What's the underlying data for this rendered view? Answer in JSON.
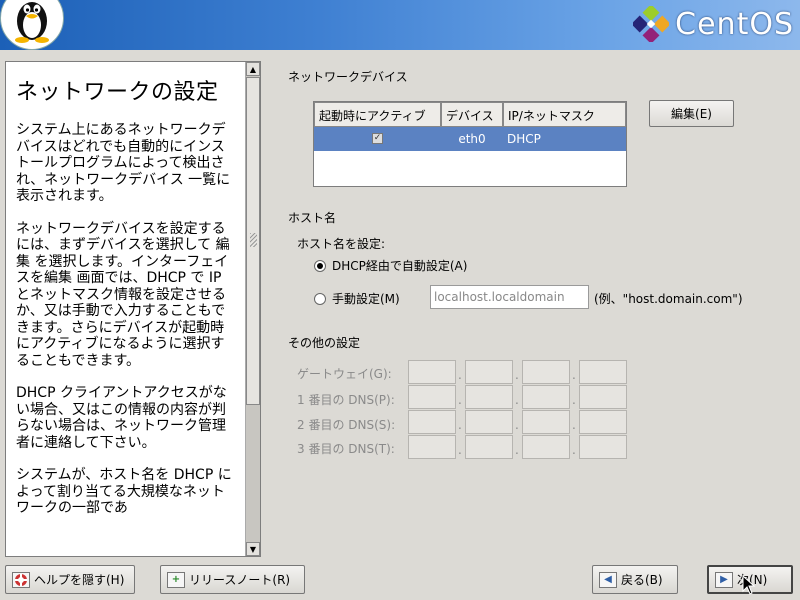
{
  "brand": {
    "name": "CentOS"
  },
  "help": {
    "title": "ネットワークの設定",
    "paragraphs": [
      "システム上にあるネットワークデバイスはどれでも自動的にインストールプログラムによって検出され、ネットワークデバイス 一覧に表示されます。",
      "ネットワークデバイスを設定するには、まずデバイスを選択して 編集 を選択します。インターフェイスを編集 画面では、DHCP で IP とネットマスク情報を設定させるか、又は手動で入力することもできます。さらにデバイスが起動時にアクティブになるように選択することもできます。",
      "DHCP クライアントアクセスがない場合、又はこの情報の内容が判らない場合は、ネットワーク管理者に連絡して下さい。",
      "システムが、ホスト名を DHCP によって割り当てる大規模なネットワークの一部であ"
    ]
  },
  "network_devices": {
    "label": "ネットワークデバイス",
    "columns": [
      "起動時にアクティブ",
      "デバイス",
      "IP/ネットマスク"
    ],
    "rows": [
      {
        "active": true,
        "device": "eth0",
        "ip": "DHCP"
      }
    ],
    "edit_button": "編集(E)"
  },
  "hostname": {
    "section_label": "ホスト名",
    "set_label": "ホスト名を設定:",
    "dhcp_option": "DHCP経由で自動設定(A)",
    "manual_option": "手動設定(M)",
    "manual_value": "localhost.localdomain",
    "example": "(例、\"host.domain.com\")",
    "selected": "dhcp"
  },
  "other_settings": {
    "section_label": "その他の設定",
    "fields": [
      {
        "label": "ゲートウェイ(G):"
      },
      {
        "label": "1 番目の DNS(P):"
      },
      {
        "label": "2 番目の DNS(S):"
      },
      {
        "label": "3 番目の DNS(T):"
      }
    ]
  },
  "buttons": {
    "hide_help": "ヘルプを隠す(H)",
    "release_notes": "リリースノート(R)",
    "back": "戻る(B)",
    "next": "次(N)"
  }
}
